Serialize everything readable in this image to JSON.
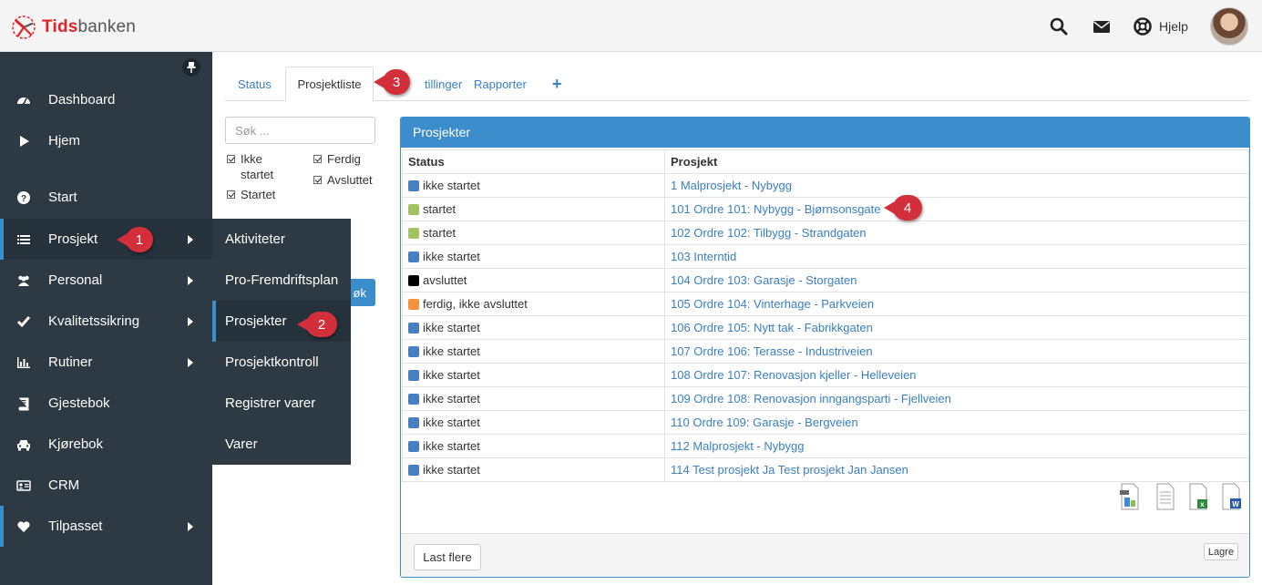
{
  "header": {
    "brand_part1": "Tids",
    "brand_part2": "banken",
    "help_label": "Hjelp",
    "icons": [
      "search-icon",
      "envelope-icon",
      "life-ring-icon",
      "avatar"
    ]
  },
  "sidebar": {
    "items": [
      {
        "label": "Dashboard",
        "icon": "dashboard-icon"
      },
      {
        "label": "Hjem",
        "icon": "play-icon"
      },
      {
        "label": "Start",
        "icon": "question-circle-icon"
      },
      {
        "label": "Prosjekt",
        "icon": "list-icon"
      },
      {
        "label": "Personal",
        "icon": "users-icon"
      },
      {
        "label": "Kvalitetssikring",
        "icon": "check-icon"
      },
      {
        "label": "Rutiner",
        "icon": "bar-chart-icon"
      },
      {
        "label": "Gjestebok",
        "icon": "book-icon"
      },
      {
        "label": "Kjørebok",
        "icon": "car-icon"
      },
      {
        "label": "CRM",
        "icon": "id-card-icon"
      },
      {
        "label": "Tilpasset",
        "icon": "heart-icon"
      }
    ]
  },
  "submenu": {
    "items": [
      "Aktiviteter",
      "Pro-Fremdriftsplan",
      "Prosjekter",
      "Prosjektkontroll",
      "Registrer varer",
      "Varer"
    ]
  },
  "markers": [
    "1",
    "2",
    "3",
    "4"
  ],
  "tabs": [
    {
      "label": "Status"
    },
    {
      "label": "Prosjektliste"
    },
    {
      "label": "tillinger"
    },
    {
      "label": "Rapporter"
    },
    {
      "label": "+"
    }
  ],
  "filters": {
    "search_placeholder": "Søk ...",
    "ikke_startet_1": "Ikke",
    "ikke_startet_2": "startet",
    "startet": "Startet",
    "ferdig": "Ferdig",
    "avsluttet": "Avsluttet",
    "search_button": "øk"
  },
  "colors": {
    "ikke_startet": "#4a7fbf",
    "startet": "#a3c363",
    "avsluttet": "#000000",
    "ferdig": "#f5923e",
    "accent": "#3c8dcc",
    "marker": "#d22f3a"
  },
  "panel": {
    "title": "Prosjekter",
    "columns": [
      "Status",
      "Prosjekt"
    ],
    "rows": [
      {
        "status": "ikke startet",
        "color": "#4a7fbf",
        "project": "1 Malprosjekt - Nybygg"
      },
      {
        "status": "startet",
        "color": "#a3c363",
        "project": "101 Ordre 101: Nybygg - Bjørnsonsgate"
      },
      {
        "status": "startet",
        "color": "#a3c363",
        "project": "102 Ordre 102: Tilbygg - Strandgaten"
      },
      {
        "status": "ikke startet",
        "color": "#4a7fbf",
        "project": "103 Interntid"
      },
      {
        "status": "avsluttet",
        "color": "#000000",
        "project": "104 Ordre 103: Garasje - Storgaten"
      },
      {
        "status": "ferdig, ikke avsluttet",
        "color": "#f5923e",
        "project": "105 Ordre 104: Vinterhage - Parkveien"
      },
      {
        "status": "ikke startet",
        "color": "#4a7fbf",
        "project": "106 Ordre 105: Nytt tak - Fabrikkgaten"
      },
      {
        "status": "ikke startet",
        "color": "#4a7fbf",
        "project": "107 Ordre 106: Terasse - Industriveien"
      },
      {
        "status": "ikke startet",
        "color": "#4a7fbf",
        "project": "108 Ordre 107: Renovasjon kjeller - Helleveien"
      },
      {
        "status": "ikke startet",
        "color": "#4a7fbf",
        "project": "109 Ordre 108: Renovasjon inngangsparti - Fjellveien"
      },
      {
        "status": "ikke startet",
        "color": "#4a7fbf",
        "project": "110 Ordre 109: Garasje - Bergveien"
      },
      {
        "status": "ikke startet",
        "color": "#4a7fbf",
        "project": "112 Malprosjekt - Nybygg"
      },
      {
        "status": "ikke startet",
        "color": "#4a7fbf",
        "project": "114 Test prosjekt Ja Test prosjekt Jan Jansen"
      }
    ],
    "export_icons": [
      "pdf-export-icon",
      "csv-export-icon",
      "excel-export-icon",
      "word-export-icon"
    ],
    "load_more": "Last flere",
    "save": "Lagre"
  }
}
